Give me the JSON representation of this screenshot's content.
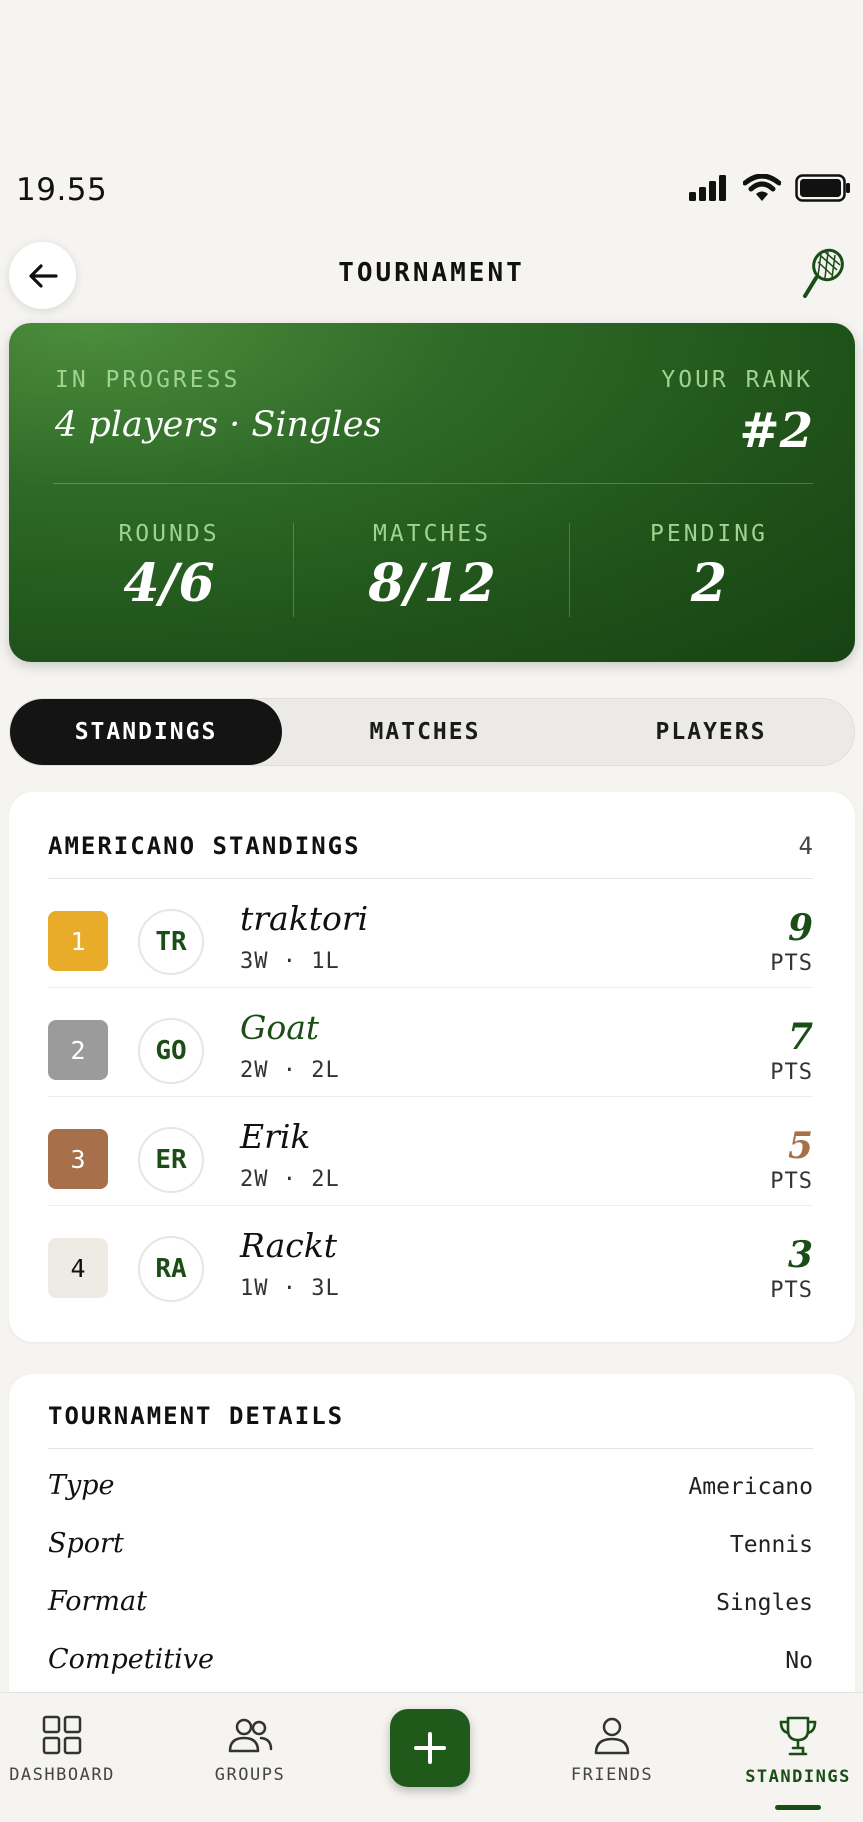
{
  "status_bar": {
    "time": "19.55"
  },
  "header": {
    "title": "TOURNAMENT"
  },
  "hero": {
    "status": "IN PROGRESS",
    "subtitle": "4 players · Singles",
    "rank_label": "YOUR RANK",
    "rank": "#2",
    "stats": [
      {
        "label": "ROUNDS",
        "value": "4/6"
      },
      {
        "label": "MATCHES",
        "value": "8/12"
      },
      {
        "label": "PENDING",
        "value": "2"
      }
    ]
  },
  "tabs": [
    {
      "label": "STANDINGS",
      "active": true
    },
    {
      "label": "MATCHES",
      "active": false
    },
    {
      "label": "PLAYERS",
      "active": false
    }
  ],
  "standings": {
    "title": "AMERICANO STANDINGS",
    "count": "4",
    "rows": [
      {
        "rank": "1",
        "initials": "TR",
        "name": "traktori",
        "record": "3W · 1L",
        "points": "9",
        "pts_label": "PTS",
        "badge_color": "#e8ac2a",
        "points_color": "#1b4d16"
      },
      {
        "rank": "2",
        "initials": "GO",
        "name": "Goat",
        "record": "2W · 2L",
        "points": "7",
        "pts_label": "PTS",
        "badge_color": "#9b9b9b",
        "points_color": "#1b4d16"
      },
      {
        "rank": "3",
        "initials": "ER",
        "name": "Erik",
        "record": "2W · 2L",
        "points": "5",
        "pts_label": "PTS",
        "badge_color": "#a8704a",
        "points_color": "#a8704a"
      },
      {
        "rank": "4",
        "initials": "RA",
        "name": "Rackt",
        "record": "1W · 3L",
        "points": "3",
        "pts_label": "PTS",
        "badge_color": "#eeebe4",
        "points_color": "#1b4d16"
      }
    ]
  },
  "details": {
    "title": "TOURNAMENT DETAILS",
    "rows": [
      {
        "label": "Type",
        "value": "Americano"
      },
      {
        "label": "Sport",
        "value": "Tennis"
      },
      {
        "label": "Format",
        "value": "Singles"
      },
      {
        "label": "Competitive",
        "value": "No"
      }
    ]
  },
  "nav": {
    "items": [
      {
        "label": "DASHBOARD",
        "icon": "grid-icon"
      },
      {
        "label": "GROUPS",
        "icon": "users-icon"
      },
      {
        "label": "FRIENDS",
        "icon": "user-icon"
      },
      {
        "label": "STANDINGS",
        "icon": "trophy-icon",
        "active": true
      }
    ],
    "fab_icon": "plus-icon"
  },
  "colors": {
    "accent": "#1b4d16",
    "hero_green": "#2e6a27",
    "background": "#f5f4f0"
  }
}
